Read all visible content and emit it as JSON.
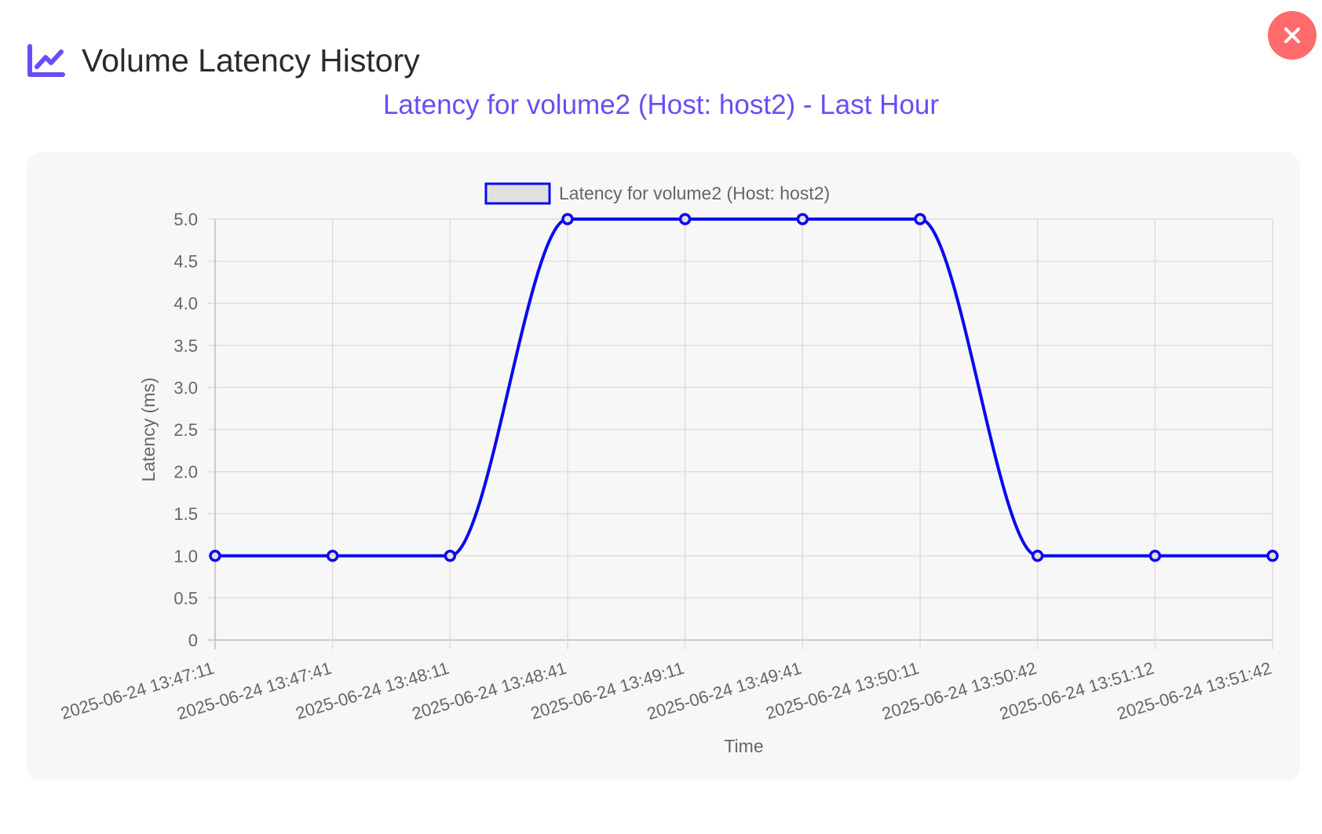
{
  "header": {
    "title": "Volume Latency History",
    "icon": "line-chart-icon",
    "close_icon": "close-icon"
  },
  "colors": {
    "accent": "#6a4df4",
    "close_bg": "#ff6b6b",
    "series": "#0a0af0",
    "legend_fill": "#e0e0e0",
    "card_bg": "#f7f7f7"
  },
  "chart_data": {
    "type": "line",
    "title": "Latency for volume2 (Host: host2) - Last Hour",
    "xlabel": "Time",
    "ylabel": "Latency (ms)",
    "ylim": [
      0,
      5
    ],
    "yticks": [
      "0",
      "0.5",
      "1.0",
      "1.5",
      "2.0",
      "2.5",
      "3.0",
      "3.5",
      "4.0",
      "4.5",
      "5.0"
    ],
    "grid": true,
    "legend_position": "top-center",
    "categories": [
      "2025-06-24 13:47:11",
      "2025-06-24 13:47:41",
      "2025-06-24 13:48:11",
      "2025-06-24 13:48:41",
      "2025-06-24 13:49:11",
      "2025-06-24 13:49:41",
      "2025-06-24 13:50:11",
      "2025-06-24 13:50:42",
      "2025-06-24 13:51:12",
      "2025-06-24 13:51:42"
    ],
    "series": [
      {
        "name": "Latency for volume2 (Host: host2)",
        "values": [
          1,
          1,
          1,
          5,
          5,
          5,
          5,
          1,
          1,
          1
        ],
        "color": "#0a0af0"
      }
    ]
  }
}
